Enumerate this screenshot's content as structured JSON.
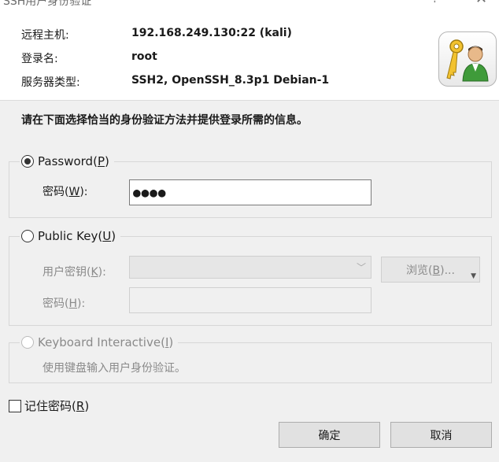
{
  "window": {
    "title": "SSH用户身份验证",
    "help_label": "?",
    "close_label": "✕"
  },
  "header": {
    "host_label": "远程主机:",
    "host_value": "192.168.249.130:22 (kali)",
    "login_label": "登录名:",
    "login_value": "root",
    "server_type_label": "服务器类型:",
    "server_type_value": "SSH2, OpenSSH_8.3p1 Debian-1",
    "logo_icon": "key-user-icon"
  },
  "instruction": "请在下面选择恰当的身份验证方法并提供登录所需的信息。",
  "password_group": {
    "label": "Password",
    "mnemonic": "P",
    "selected": true,
    "field_label": "密码",
    "field_mnemonic": "W",
    "field_value": "●●●●"
  },
  "pubkey_group": {
    "label": "Public Key",
    "mnemonic": "U",
    "selected": false,
    "key_label": "用户密钥",
    "key_mnemonic": "K",
    "browse_label": "浏览",
    "browse_mnemonic": "B",
    "passphrase_label": "密码",
    "passphrase_mnemonic": "H"
  },
  "keyboard_group": {
    "label": "Keyboard Interactive",
    "mnemonic": "I",
    "description": "使用键盘输入用户身份验证。"
  },
  "remember": {
    "label": "记住密码",
    "mnemonic": "R",
    "checked": false
  },
  "buttons": {
    "ok": "确定",
    "cancel": "取消"
  }
}
